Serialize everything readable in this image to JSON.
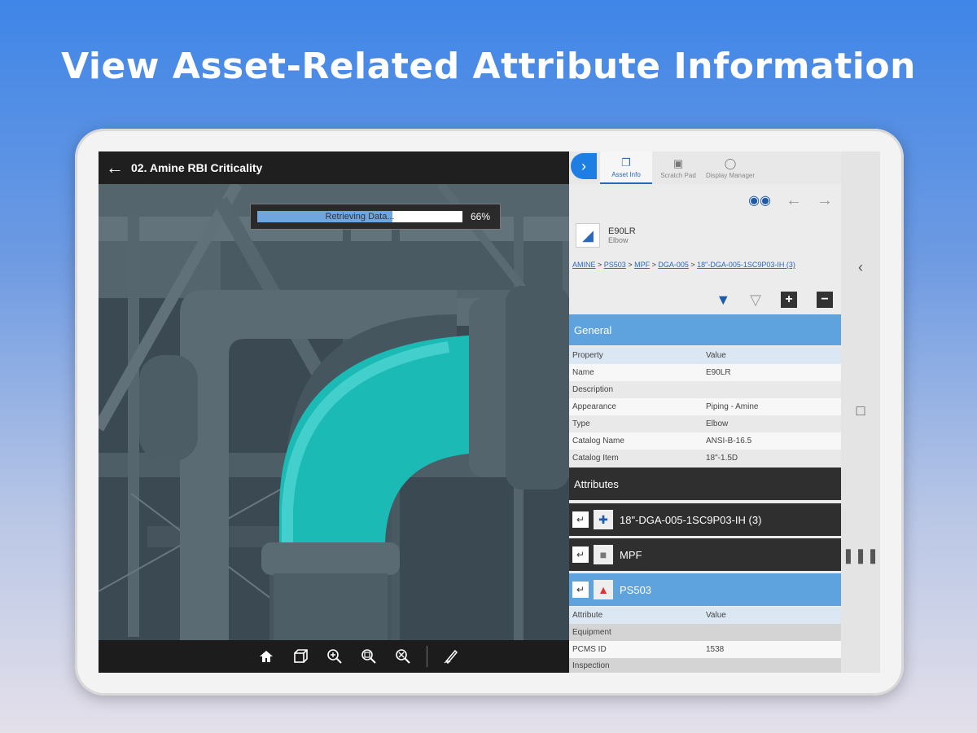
{
  "headline": "View Asset-Related Attribute Information",
  "viewer": {
    "back_icon": "arrow-left-icon",
    "title": "02. Amine RBI Criticality",
    "progress": {
      "label": "Retrieving Data...",
      "percent_text": "66%",
      "fraction": 0.66
    },
    "tools": [
      "home-icon",
      "cube-icon",
      "zoom-extents-icon",
      "zoom-window-icon",
      "zoom-selection-icon",
      "markup-pen-icon"
    ]
  },
  "panel": {
    "tabs": [
      {
        "label": "Asset Info",
        "active": true
      },
      {
        "label": "Scratch Pad",
        "active": false
      },
      {
        "label": "Display Manager",
        "active": false
      }
    ],
    "asset": {
      "name": "E90LR",
      "type": "Elbow"
    },
    "breadcrumbs": [
      "AMINE",
      "PS503",
      "MPF",
      "DGA-005",
      "18\"-DGA-005-1SC9P03-IH (3)"
    ],
    "general": {
      "title": "General",
      "header": {
        "property": "Property",
        "value": "Value"
      },
      "rows": [
        {
          "property": "Name",
          "value": "E90LR"
        },
        {
          "property": "Description",
          "value": ""
        },
        {
          "property": "Appearance",
          "value": "Piping - Amine"
        },
        {
          "property": "Type",
          "value": "Elbow"
        },
        {
          "property": "Catalog Name",
          "value": "ANSI-B-16.5"
        },
        {
          "property": "Catalog Item",
          "value": "18\"-1.5D"
        }
      ]
    },
    "attributes": {
      "title": "Attributes",
      "nodes": [
        {
          "label": "18\"-DGA-005-1SC9P03-IH (3)"
        },
        {
          "label": "MPF"
        },
        {
          "label": "PS503"
        }
      ],
      "header": {
        "attribute": "Attribute",
        "value": "Value"
      },
      "rows": [
        {
          "attribute": "Equipment",
          "value": "",
          "group": true
        },
        {
          "attribute": "PCMS ID",
          "value": "1538",
          "group": false
        },
        {
          "attribute": "Inspection",
          "value": "",
          "group": true
        }
      ]
    }
  },
  "colors": {
    "accent": "#1e7ee4",
    "section_blue": "#5ea3de",
    "pipe_teal": "#1bbab5"
  }
}
